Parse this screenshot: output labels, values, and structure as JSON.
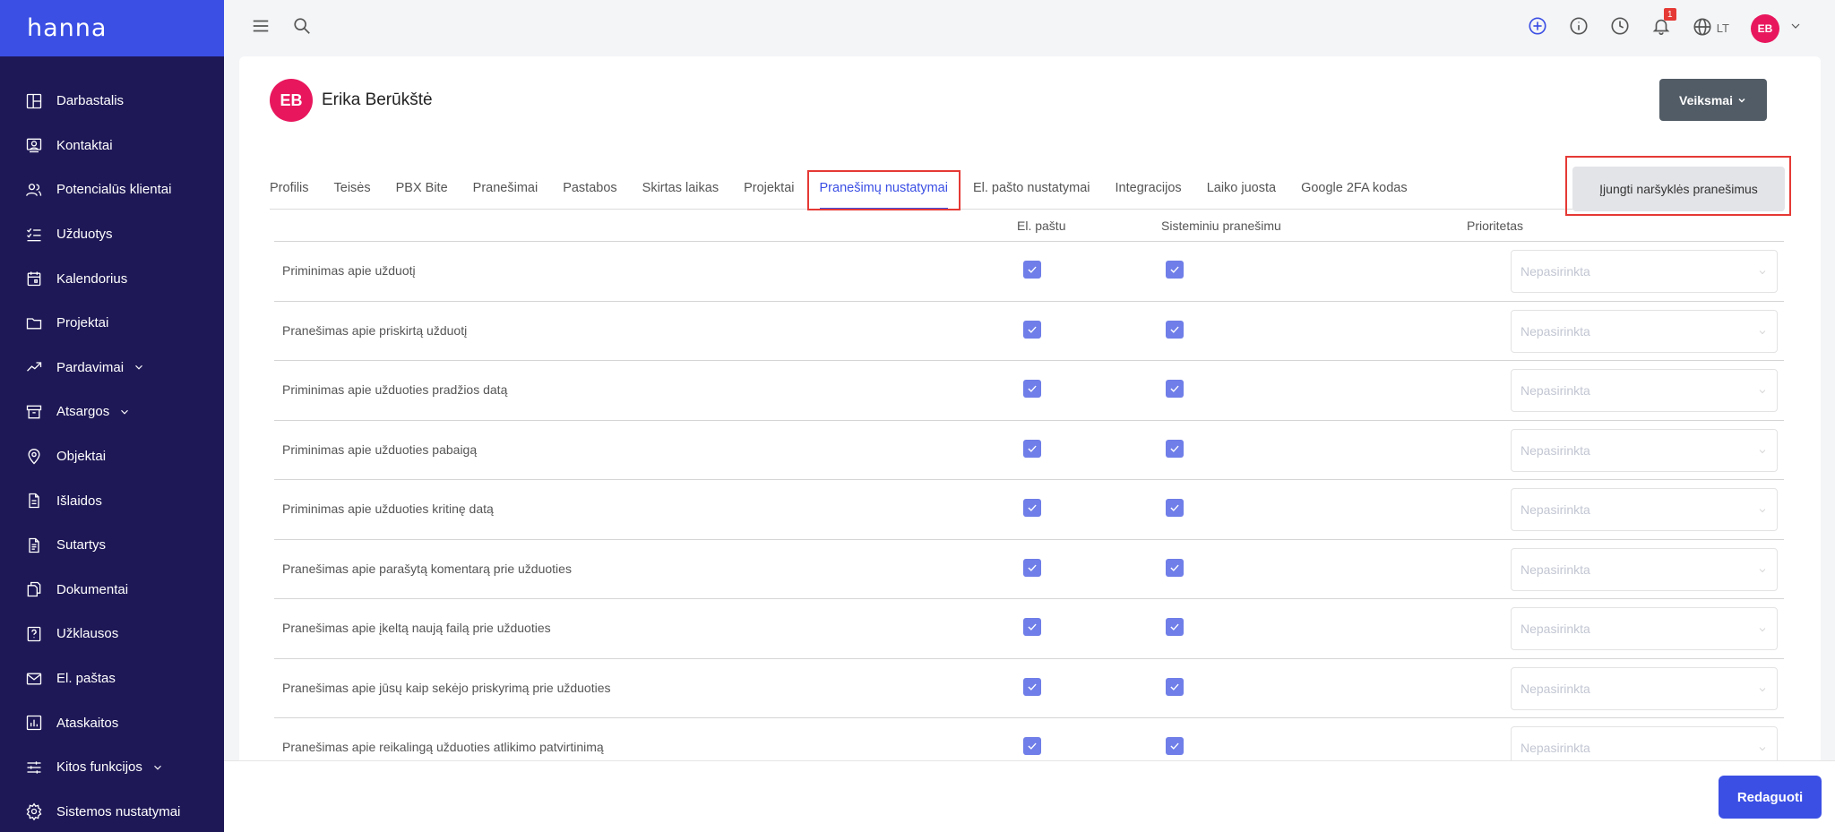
{
  "app": {
    "logo": "hanna"
  },
  "sidebar": {
    "items": [
      {
        "label": "Darbastalis",
        "icon": "dashboard-icon",
        "expandable": false
      },
      {
        "label": "Kontaktai",
        "icon": "contacts-icon",
        "expandable": false
      },
      {
        "label": "Potencialūs klientai",
        "icon": "leads-icon",
        "expandable": false
      },
      {
        "label": "Užduotys",
        "icon": "tasks-icon",
        "expandable": false
      },
      {
        "label": "Kalendorius",
        "icon": "calendar-icon",
        "expandable": false
      },
      {
        "label": "Projektai",
        "icon": "folder-icon",
        "expandable": false
      },
      {
        "label": "Pardavimai",
        "icon": "trending-up-icon",
        "expandable": true
      },
      {
        "label": "Atsargos",
        "icon": "archive-icon",
        "expandable": true
      },
      {
        "label": "Objektai",
        "icon": "map-pin-icon",
        "expandable": false
      },
      {
        "label": "Išlaidos",
        "icon": "receipt-icon",
        "expandable": false
      },
      {
        "label": "Sutartys",
        "icon": "contract-icon",
        "expandable": false
      },
      {
        "label": "Dokumentai",
        "icon": "documents-icon",
        "expandable": false
      },
      {
        "label": "Užklausos",
        "icon": "question-icon",
        "expandable": false
      },
      {
        "label": "El. paštas",
        "icon": "mail-icon",
        "expandable": false
      },
      {
        "label": "Ataskaitos",
        "icon": "reports-icon",
        "expandable": false
      },
      {
        "label": "Kitos funkcijos",
        "icon": "sliders-icon",
        "expandable": true
      },
      {
        "label": "Sistemos nustatymai",
        "icon": "gear-icon",
        "expandable": false
      }
    ]
  },
  "topbar": {
    "notifications_count": "1",
    "language": "LT",
    "user_initials": "EB"
  },
  "profile": {
    "initials": "EB",
    "name": "Erika Berūkštė",
    "actions_label": "Veiksmai"
  },
  "tabs": [
    {
      "label": "Profilis",
      "active": false
    },
    {
      "label": "Teisės",
      "active": false
    },
    {
      "label": "PBX Bite",
      "active": false
    },
    {
      "label": "Pranešimai",
      "active": false
    },
    {
      "label": "Pastabos",
      "active": false
    },
    {
      "label": "Skirtas laikas",
      "active": false
    },
    {
      "label": "Projektai",
      "active": false
    },
    {
      "label": "Pranešimų nustatymai",
      "active": true
    },
    {
      "label": "El. pašto nustatymai",
      "active": false
    },
    {
      "label": "Integracijos",
      "active": false
    },
    {
      "label": "Laiko juosta",
      "active": false
    },
    {
      "label": "Google 2FA kodas",
      "active": false
    }
  ],
  "browser_notifications_label": "Įjungti naršyklės pranešimus",
  "table": {
    "headers": {
      "email": "El. paštu",
      "system": "Sisteminiu pranešimu",
      "priority": "Prioritetas"
    },
    "select_placeholder": "Nepasirinkta",
    "rows": [
      {
        "label": "Priminimas apie užduotį",
        "email": true,
        "system": true
      },
      {
        "label": "Pranešimas apie priskirtą užduotį",
        "email": true,
        "system": true
      },
      {
        "label": "Priminimas apie užduoties pradžios datą",
        "email": true,
        "system": true
      },
      {
        "label": "Priminimas apie užduoties pabaigą",
        "email": true,
        "system": true
      },
      {
        "label": "Priminimas apie užduoties kritinę datą",
        "email": true,
        "system": true
      },
      {
        "label": "Pranešimas apie parašytą komentarą prie užduoties",
        "email": true,
        "system": true
      },
      {
        "label": "Pranešimas apie įkeltą naują failą prie užduoties",
        "email": true,
        "system": true
      },
      {
        "label": "Pranešimas apie jūsų kaip sekėjo priskyrimą prie užduoties",
        "email": true,
        "system": true
      },
      {
        "label": "Pranešimas apie reikalingą užduoties atlikimo patvirtinimą",
        "email": true,
        "system": true
      }
    ]
  },
  "footer": {
    "edit_label": "Redaguoti"
  },
  "colors": {
    "sidebar_bg": "#1e1856",
    "accent": "#3b4fe4",
    "avatar": "#e8175d",
    "checkbox": "#6f7ee8",
    "highlight": "#e53935"
  }
}
